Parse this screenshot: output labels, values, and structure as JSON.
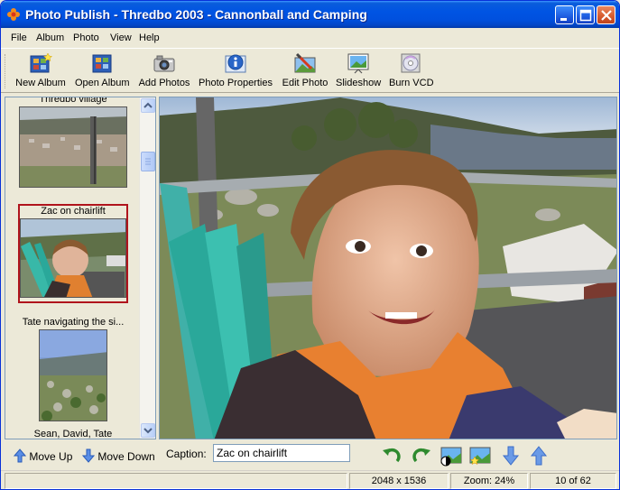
{
  "window": {
    "title": "Photo Publish - Thredbo 2003 - Cannonball and Camping"
  },
  "menu": {
    "items": [
      {
        "label": "File"
      },
      {
        "label": "Album"
      },
      {
        "label": "Photo"
      },
      {
        "label": "View"
      },
      {
        "label": "Help"
      }
    ]
  },
  "toolbar": {
    "buttons": [
      {
        "label": "New Album",
        "icon": "new-album-icon"
      },
      {
        "label": "Open Album",
        "icon": "open-album-icon"
      },
      {
        "label": "Add Photos",
        "icon": "camera-icon"
      },
      {
        "label": "Photo Properties",
        "icon": "info-icon"
      },
      {
        "label": "Edit Photo",
        "icon": "edit-photo-icon"
      },
      {
        "label": "Slideshow",
        "icon": "slideshow-icon"
      },
      {
        "label": "Burn VCD",
        "icon": "cd-icon"
      }
    ]
  },
  "thumbnails": [
    {
      "caption": "Thredbo village",
      "selected": false
    },
    {
      "caption": "Zac on chairlift",
      "selected": true
    },
    {
      "caption": "Tate navigating the si...",
      "selected": false
    },
    {
      "caption": "Sean, David, Tate",
      "selected": false
    }
  ],
  "bottom": {
    "move_up": "Move Up",
    "move_down": "Move Down",
    "caption_label": "Caption:",
    "caption_value": "Zac on chairlift"
  },
  "status": {
    "dimensions": "2048 x 1536",
    "zoom": "Zoom: 24%",
    "position": "10 of 62"
  }
}
